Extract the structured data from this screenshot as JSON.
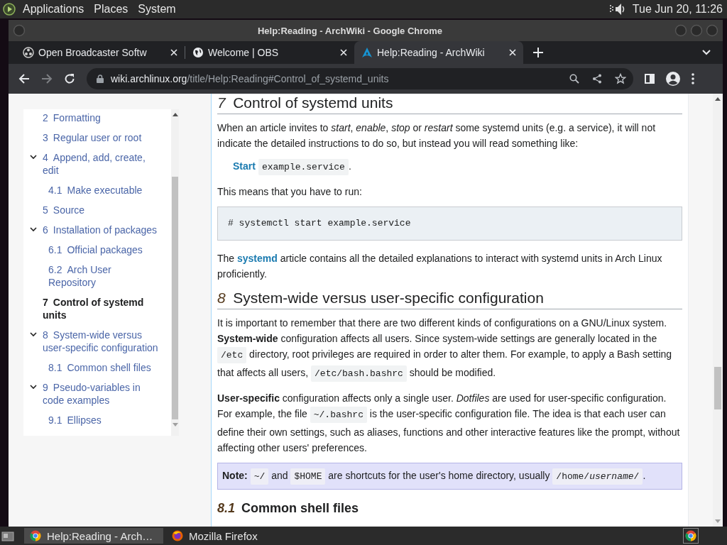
{
  "top_panel": {
    "menus": [
      "Applications",
      "Places",
      "System"
    ],
    "clock": "Tue Jun 20, 11:26"
  },
  "window": {
    "title": "Help:Reading - ArchWiki - Google Chrome"
  },
  "tabs": [
    {
      "title": "Open Broadcaster Softw",
      "selected": false
    },
    {
      "title": "Welcome | OBS",
      "selected": false
    },
    {
      "title": "Help:Reading - ArchWiki",
      "selected": true
    }
  ],
  "address": {
    "host": "wiki.archlinux.org",
    "path": "/title/Help:Reading#Control_of_systemd_units"
  },
  "toc": {
    "items": [
      {
        "number": "2",
        "label": "Formatting",
        "selected": false
      },
      {
        "number": "3",
        "label": "Regular user or root",
        "selected": false
      },
      {
        "number": "4",
        "label": "Append, add, create, edit",
        "selected": false,
        "expanded": true,
        "children": [
          {
            "number": "4.1",
            "label": "Make executable",
            "selected": false
          }
        ]
      },
      {
        "number": "5",
        "label": "Source",
        "selected": false
      },
      {
        "number": "6",
        "label": "Installation of packages",
        "selected": false,
        "expanded": true,
        "children": [
          {
            "number": "6.1",
            "label": "Official packages",
            "selected": false
          },
          {
            "number": "6.2",
            "label": "Arch User Repository",
            "selected": false
          }
        ]
      },
      {
        "number": "7",
        "label": "Control of systemd units",
        "selected": true
      },
      {
        "number": "8",
        "label": "System-wide versus user-specific configuration",
        "selected": false,
        "expanded": true,
        "children": [
          {
            "number": "8.1",
            "label": "Common shell files",
            "selected": false
          }
        ]
      },
      {
        "number": "9",
        "label": "Pseudo-variables in code examples",
        "selected": false,
        "expanded": true,
        "children": [
          {
            "number": "9.1",
            "label": "Ellipses",
            "selected": false
          }
        ]
      }
    ]
  },
  "content": [
    {
      "kind": "heading2",
      "number": "7",
      "text": "Control of systemd units"
    },
    {
      "kind": "paragraph",
      "segments": [
        {
          "kind": "text",
          "text": "When an article invites to *start*, *enable*, *stop* or *restart* some systemd units (e.g. a service), it will not indicate the detailed instructions to do so, but instead you will read something like:"
        }
      ]
    },
    {
      "kind": "template",
      "segments": [
        {
          "kind": "link",
          "text": "Start"
        },
        {
          "kind": "code",
          "text": "example.service"
        },
        {
          "kind": "text",
          "text": "."
        }
      ]
    },
    {
      "kind": "paragraph",
      "segments": [
        {
          "kind": "text",
          "text": "This means that you have to run:"
        }
      ]
    },
    {
      "kind": "pre",
      "text": "# systemctl start example.service"
    },
    {
      "kind": "paragraph",
      "segments": [
        {
          "kind": "text",
          "text": "The "
        },
        {
          "kind": "link",
          "text": "systemd"
        },
        {
          "kind": "text",
          "text": " article contains all the detailed explanations to interact with systemd units in Arch Linux proficiently."
        }
      ]
    },
    {
      "kind": "heading2",
      "number": "8",
      "text": "System-wide versus user-specific configuration"
    },
    {
      "kind": "paragraph",
      "segments": [
        {
          "kind": "text",
          "text": "It is important to remember that there are two different kinds of configurations on a GNU/Linux system. **System-wide** configuration affects all users. Since system-wide settings are generally located in the "
        },
        {
          "kind": "code",
          "text": "/etc"
        },
        {
          "kind": "text",
          "text": " directory, root privileges are required in order to alter them. For example, to apply a Bash setting that affects all users, "
        },
        {
          "kind": "code",
          "text": "/etc/bash.bashrc"
        },
        {
          "kind": "text",
          "text": " should be modified."
        }
      ]
    },
    {
      "kind": "paragraph",
      "segments": [
        {
          "kind": "text",
          "text": "**User-specific** configuration affects only a single user. *Dotfiles* are used for user-specific configuration. For example, the file "
        },
        {
          "kind": "code",
          "text": "~/.bashrc"
        },
        {
          "kind": "text",
          "text": " is the user-specific configuration file. The idea is that each user can define their own settings, such as aliases, functions and other interactive features like the prompt, without affecting other users' preferences."
        }
      ]
    },
    {
      "kind": "note",
      "segments": [
        {
          "kind": "text",
          "text": "**Note:** "
        },
        {
          "kind": "code",
          "text": "~/"
        },
        {
          "kind": "text",
          "text": " and "
        },
        {
          "kind": "code",
          "text": "$HOME"
        },
        {
          "kind": "text",
          "text": " are shortcuts for the user's home directory, usually "
        },
        {
          "kind": "code",
          "text": "/home/*username*/"
        },
        {
          "kind": "text",
          "text": "."
        }
      ]
    },
    {
      "kind": "heading3",
      "number": "8.1",
      "text": "Common shell files"
    }
  ],
  "taskbar": {
    "items": [
      {
        "title": "Help:Reading - Arch…",
        "selected": true
      },
      {
        "title": "Mozilla Firefox",
        "selected": false
      }
    ]
  }
}
